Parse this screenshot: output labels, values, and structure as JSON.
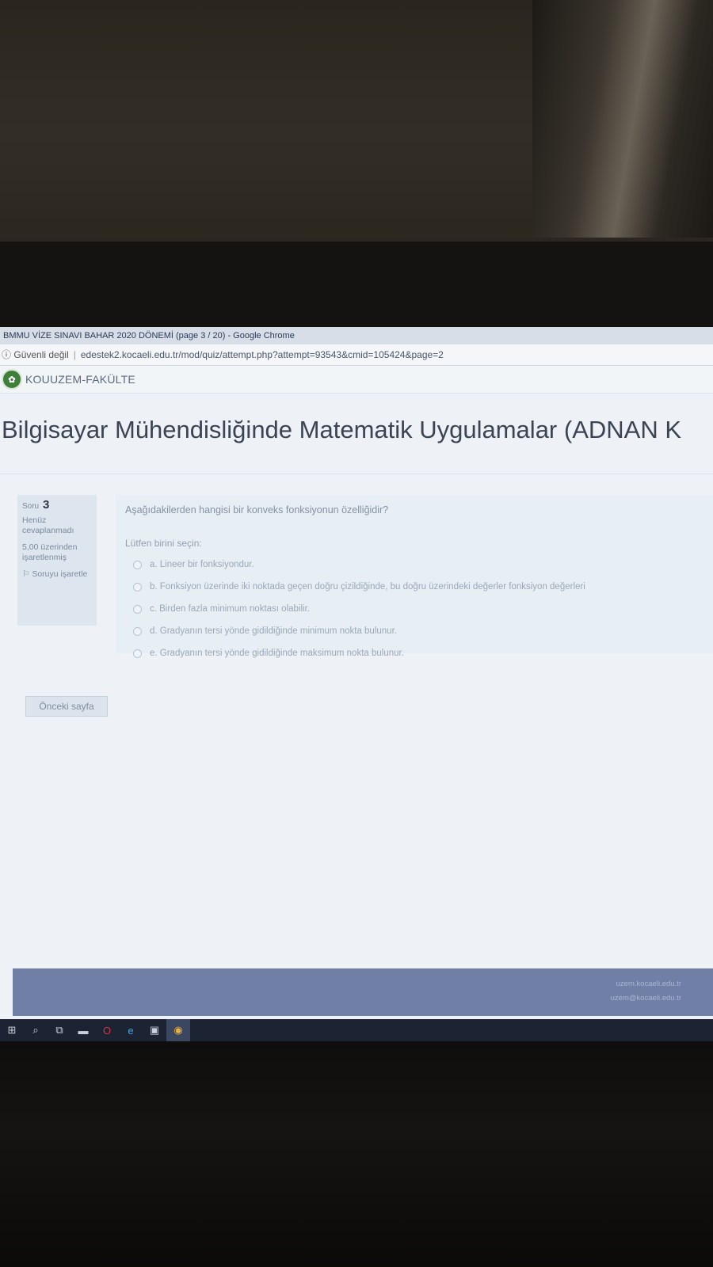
{
  "browser": {
    "window_title": "BMMU VİZE SINAVI BAHAR 2020 DÖNEMİ (page 3 / 20) - Google Chrome",
    "security_label": "Güvenli değil",
    "url": "edestek2.kocaeli.edu.tr/mod/quiz/attempt.php?attempt=93543&cmid=105424&page=2"
  },
  "site": {
    "brand": "KOUUZEM-FAKÜLTE",
    "course_title": "Bilgisayar Mühendisliğinde Matematik Uygulamalar (ADNAN K"
  },
  "question_info": {
    "label": "Soru",
    "number": "3",
    "state": "Henüz cevaplanmadı",
    "mark": "5,00 üzerinden işaretlenmiş",
    "flag": "Soruyu işaretle"
  },
  "question": {
    "text": "Aşağıdakilerden hangisi bir konveks fonksiyonun özelliğidir?",
    "prompt": "Lütfen birini seçin:",
    "answers": [
      "a. Lineer bir fonksiyondur.",
      "b. Fonksiyon üzerinde iki noktada geçen doğru çizildiğinde, bu doğru üzerindeki değerler fonksiyon değerleri",
      "c. Birden fazla minimum noktası olabilir.",
      "d. Gradyanın tersi yönde gidildiğinde minimum nokta bulunur.",
      "e. Gradyanın tersi yönde gidildiğinde maksimum nokta bulunur."
    ]
  },
  "navigation": {
    "previous_label": "Önceki sayfa"
  },
  "footer": {
    "line1": "uzem.kocaeli.edu.tr",
    "line2": "uzem@kocaeli.edu.tr"
  },
  "taskbar": {
    "icons": [
      "windows-start-icon",
      "search-icon",
      "task-view-icon",
      "file-explorer-icon",
      "opera-icon",
      "edge-icon",
      "store-icon",
      "chrome-icon"
    ]
  },
  "colors": {
    "footer_bg": "#6f7fa6",
    "logo_green": "#3f7f3a",
    "taskbar_bg": "#1c2333"
  }
}
